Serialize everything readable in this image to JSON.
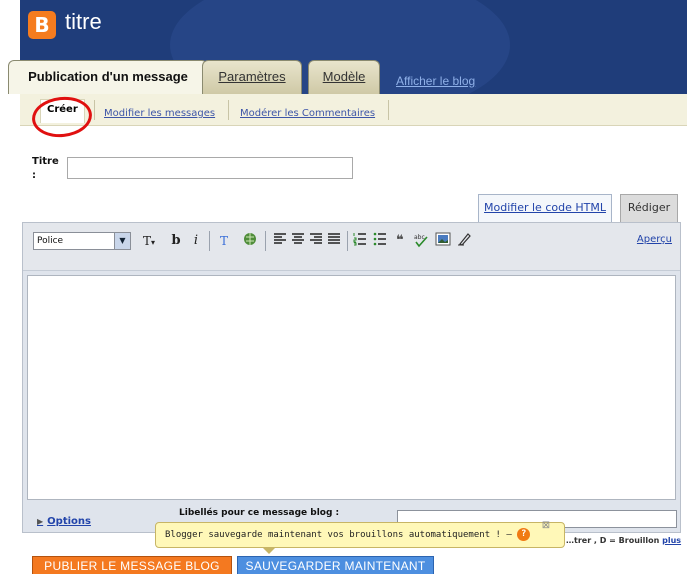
{
  "header": {
    "logo_letter": "B",
    "blog_title": "titre",
    "tabs": [
      {
        "label": "Publication d'un message",
        "active": true
      },
      {
        "label": "Paramètres",
        "active": false
      },
      {
        "label": "Modèle",
        "active": false
      }
    ],
    "view_blog_link": "Afficher le blog"
  },
  "subnav": {
    "items": [
      "Créer",
      "Modifier les messages",
      "Modérer les Commentaires"
    ]
  },
  "post": {
    "title_label": "Titre\n:",
    "title_value": ""
  },
  "editor": {
    "mode_tabs": {
      "html": "Modifier le code HTML",
      "compose": "Rédiger"
    },
    "font_select": "Police",
    "toolbar": {
      "text_size": "T",
      "bold": "b",
      "italic": "i",
      "color": "T"
    },
    "preview_link": "Aperçu",
    "options_link": "Options",
    "labels_title": "Libellés pour ce message blog :",
    "labels_value": ""
  },
  "notification": {
    "message": "Blogger sauvegarde maintenant vos brouillons automatiquement ! –",
    "help_glyph": "?",
    "close_glyph": "⊠"
  },
  "hint": {
    "text": "…trer , D = Brouillon",
    "more_link": "plus"
  },
  "buttons": {
    "publish": "PUBLIER LE MESSAGE BLOG",
    "save": "SAUVEGARDER MAINTENANT"
  },
  "colors": {
    "header_bg": "#1f3d7a",
    "accent_orange": "#f47920",
    "accent_blue": "#4d8fe0",
    "link": "#2244aa"
  }
}
